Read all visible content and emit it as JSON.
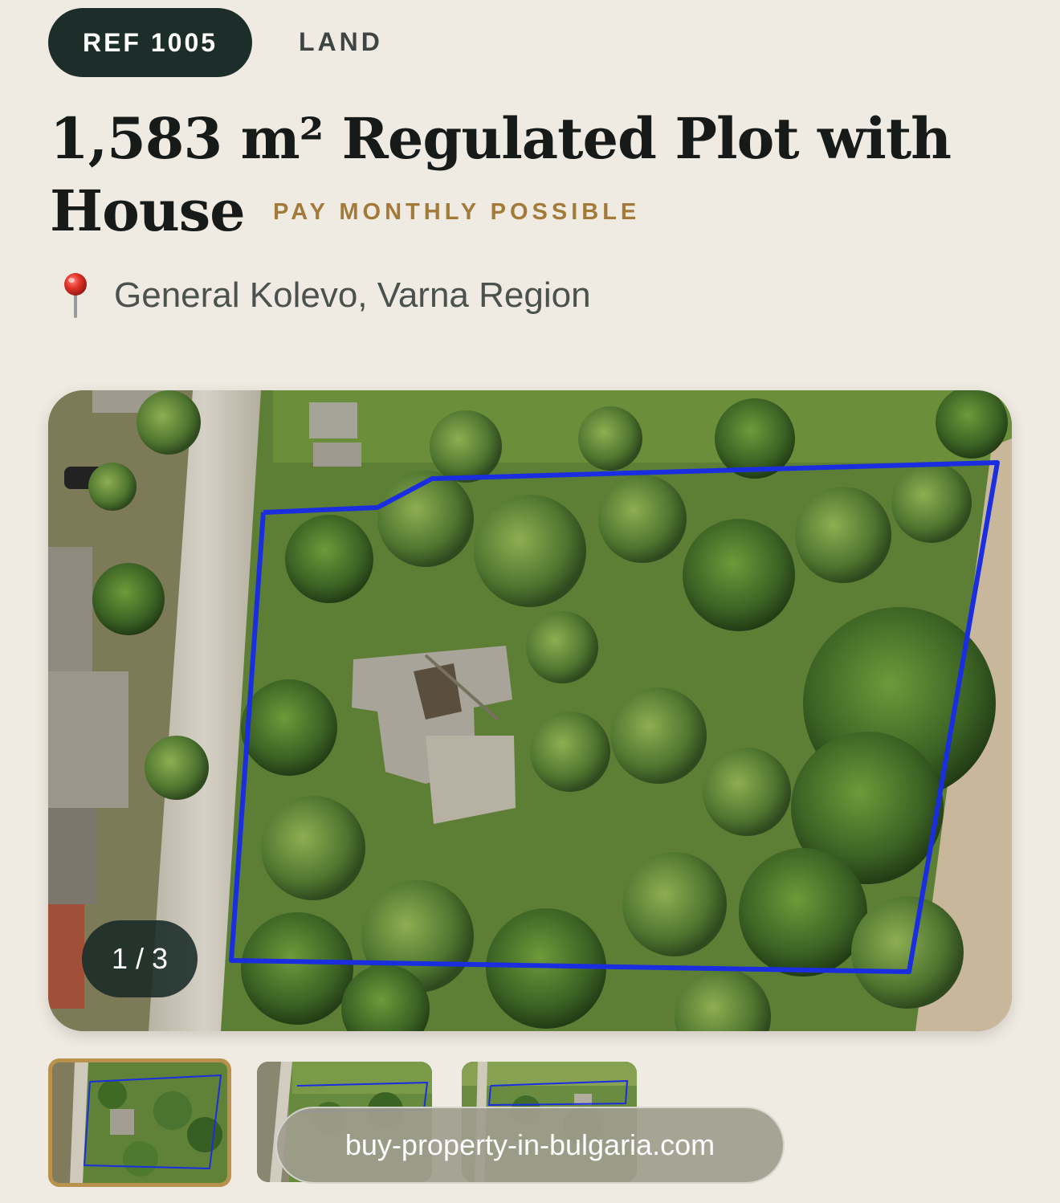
{
  "listing": {
    "ref_label": "REF 1005",
    "category": "LAND",
    "title": "1,583 m² Regulated Plot with House",
    "badge": "PAY MONTHLY POSSIBLE",
    "location": "General Kolevo, Varna Region"
  },
  "gallery": {
    "counter": "1 / 3",
    "current_index": 1,
    "total": 3,
    "thumbnail_count": 3
  },
  "watermark": {
    "text": "buy-property-in-bulgaria.com"
  },
  "colors": {
    "background": "#f0ebe2",
    "ref_badge_bg": "#1d2e2a",
    "accent_gold": "#a27b3a",
    "plot_outline": "#1a2ee0",
    "selected_thumb_border": "#b8914c"
  },
  "icons": {
    "location": "pin-icon"
  }
}
